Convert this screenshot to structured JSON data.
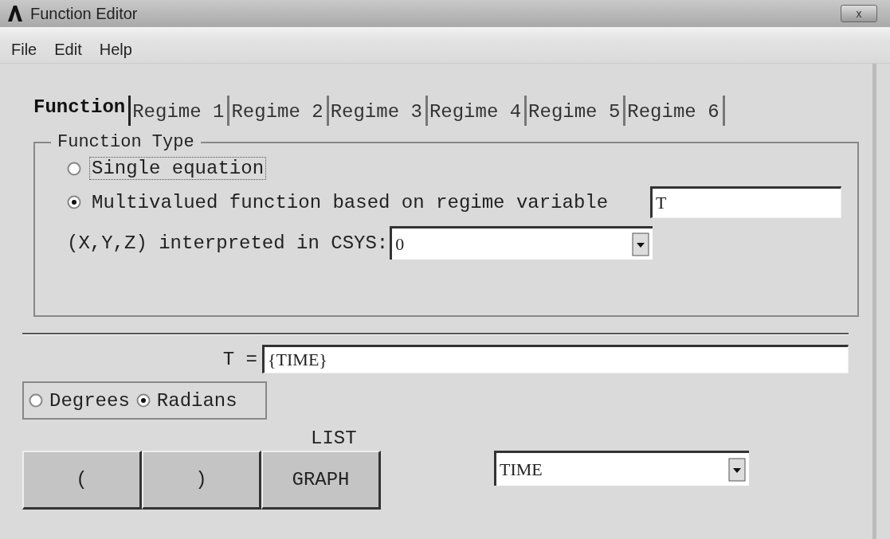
{
  "window": {
    "title": "Function Editor",
    "close": "x"
  },
  "menu": [
    "File",
    "Edit",
    "Help"
  ],
  "tabs": [
    {
      "label": "Function",
      "selected": true
    },
    {
      "label": "Regime 1",
      "selected": false
    },
    {
      "label": "Regime 2",
      "selected": false
    },
    {
      "label": "Regime 3",
      "selected": false
    },
    {
      "label": "Regime 4",
      "selected": false
    },
    {
      "label": "Regime 5",
      "selected": false
    },
    {
      "label": "Regime 6",
      "selected": false
    }
  ],
  "function_type": {
    "title": "Function Type",
    "options": [
      {
        "label": "Single equation",
        "selected": false,
        "focused": true
      },
      {
        "label": "Multivalued function based on regime variable",
        "selected": true,
        "focused": false
      }
    ],
    "regime_variable": {
      "value": "T"
    },
    "csys": {
      "label": "(X,Y,Z) interpreted in CSYS:",
      "value": "0"
    }
  },
  "equation": {
    "label": "T =",
    "value": "{TIME}"
  },
  "angle_units": [
    {
      "label": "Degrees",
      "selected": false
    },
    {
      "label": "Radians",
      "selected": true
    }
  ],
  "list_label": "LIST",
  "buttons": [
    "(",
    ")",
    "GRAPH"
  ],
  "variable_select": {
    "value": "TIME"
  }
}
